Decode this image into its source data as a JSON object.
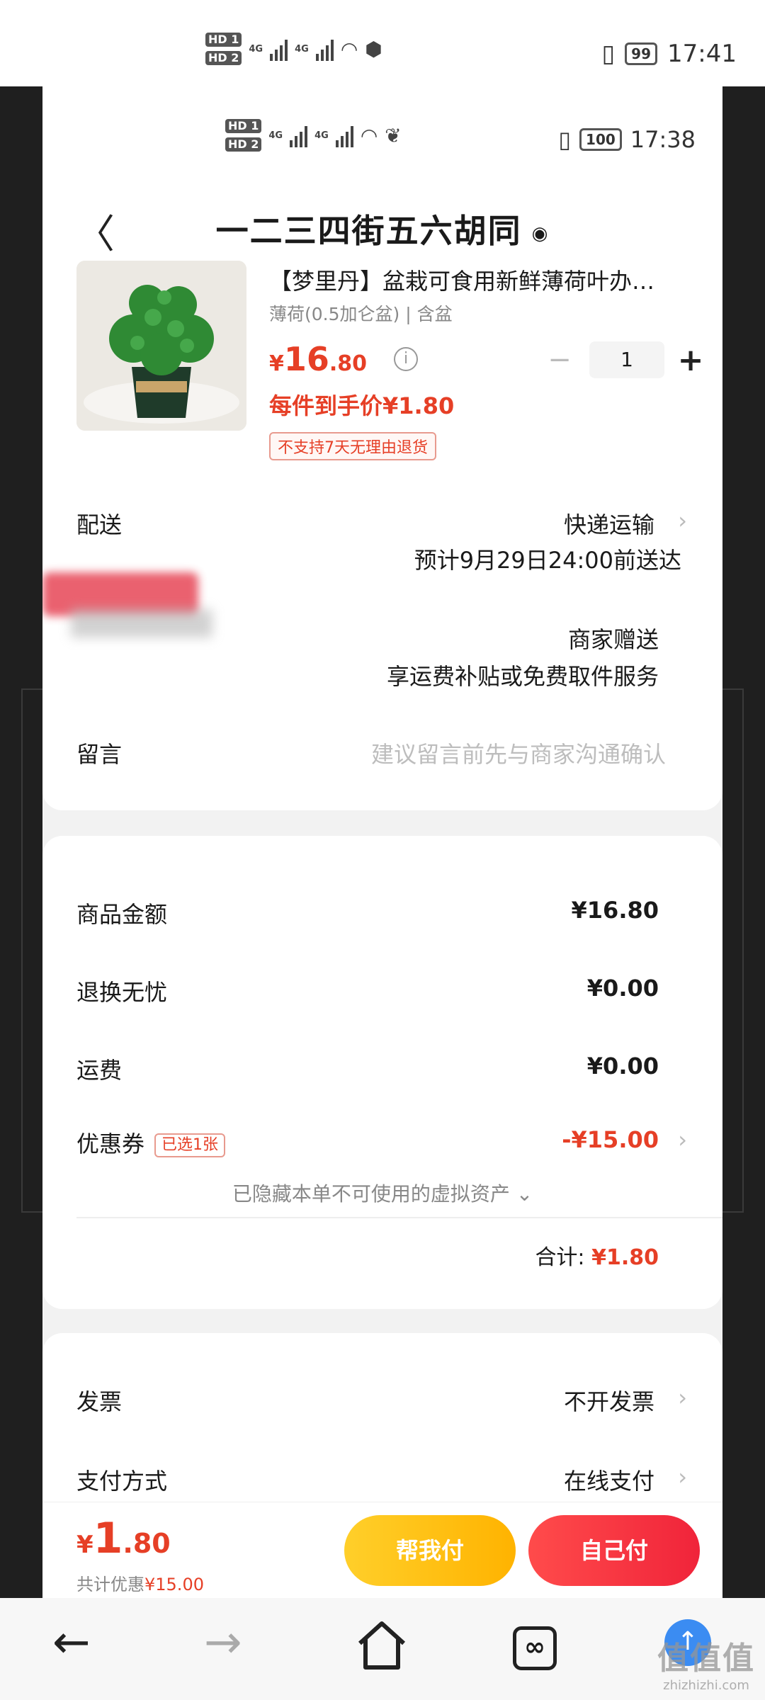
{
  "outer_status": {
    "network1": "4G",
    "network2": "4G",
    "battery": "99",
    "time": "17:41"
  },
  "inner_status": {
    "network1": "4G",
    "network2": "4G",
    "battery": "100",
    "time": "17:38"
  },
  "header": {
    "title": "一二三四街五六胡同"
  },
  "product": {
    "name": "【梦里丹】盆栽可食用新鲜薄荷叶办…",
    "spec": "薄荷(0.5加仑盆) | 含盆",
    "price_symbol": "¥",
    "price_int": "16",
    "price_dec": ".80",
    "quantity": "1",
    "hand_price": "每件到手价¥1.80",
    "return_tag": "不支持7天无理由退货"
  },
  "delivery": {
    "label": "配送",
    "method": "快递运输",
    "eta": "预计9月29日24:00前送达"
  },
  "insurance": {
    "value": "商家赠送",
    "desc": "享运费补贴或免费取件服务"
  },
  "message": {
    "label": "留言",
    "placeholder": "建议留言前先与商家沟通确认"
  },
  "summary": {
    "goods_label": "商品金额",
    "goods_value": "¥16.80",
    "return_label": "退换无忧",
    "return_value": "¥0.00",
    "freight_label": "运费",
    "freight_value": "¥0.00",
    "coupon_label": "优惠券",
    "coupon_tag": "已选1张",
    "coupon_value": "-¥15.00",
    "hidden_note": "已隐藏本单不可使用的虚拟资产 ⌄",
    "total_label": "合计:",
    "total_value": "¥1.80"
  },
  "extras": {
    "invoice_label": "发票",
    "invoice_value": "不开发票",
    "pay_label": "支付方式",
    "pay_value": "在线支付"
  },
  "bottom": {
    "price_symbol": "¥",
    "price_int": "1",
    "price_dec": ".80",
    "saved_prefix": "共计优惠",
    "saved_value": "¥15.00",
    "help_pay": "帮我付",
    "self_pay": "自己付"
  },
  "watermark": {
    "main": "值值值",
    "sub": "zhizhizhi.com"
  }
}
